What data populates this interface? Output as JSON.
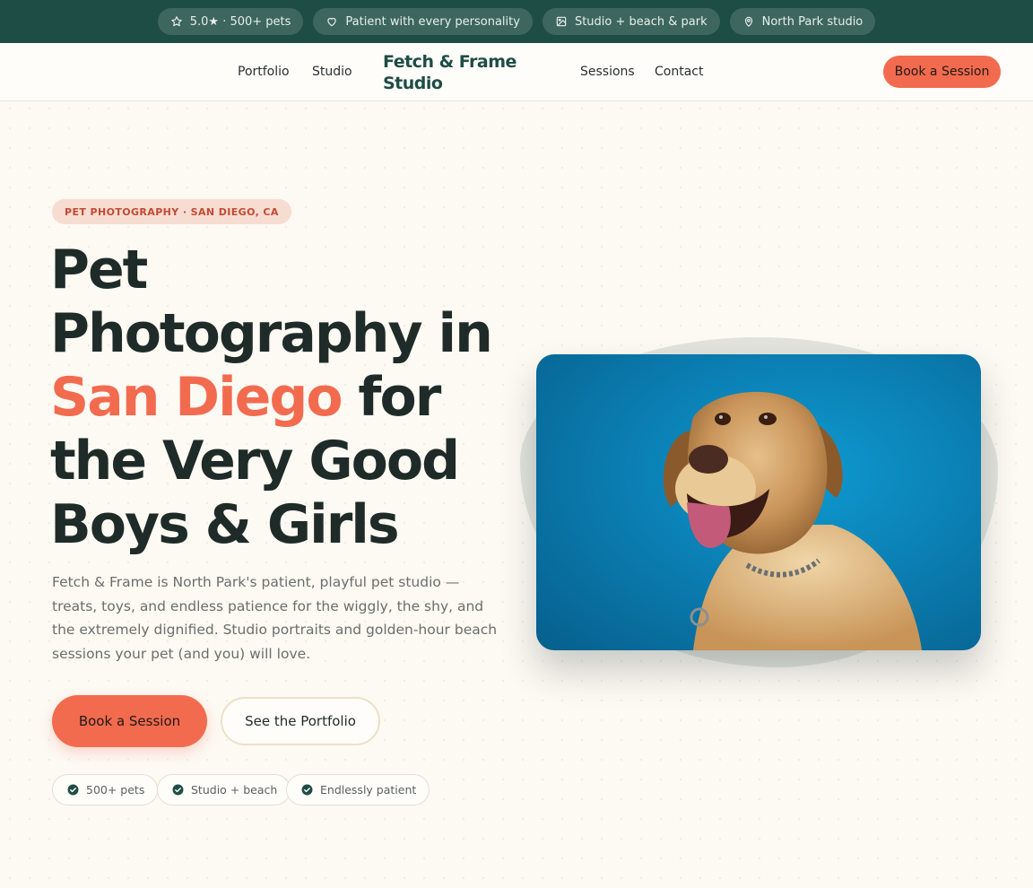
{
  "topbar": {
    "items": [
      {
        "icon": "star-icon",
        "label": "5.0★ · 500+ pets"
      },
      {
        "icon": "heart-icon",
        "label": "Patient with every personality"
      },
      {
        "icon": "image-icon",
        "label": "Studio + beach & park"
      },
      {
        "icon": "map-pin-icon",
        "label": "North Park studio"
      }
    ]
  },
  "nav": {
    "links": [
      "Portfolio",
      "Studio",
      "Sessions",
      "Contact"
    ],
    "logo_line1": "Fetch & Frame",
    "logo_line2": "Studio",
    "cta": "Book a Session"
  },
  "hero": {
    "eyebrow": "PET PHOTOGRAPHY · SAN DIEGO, CA",
    "headline_line1": "Pet",
    "headline_line2": "Photography in",
    "headline_accent": "San Diego",
    "headline_line3_rest": " for",
    "headline_line4": "the Very Good",
    "headline_line5": "Boys & Girls",
    "lede": "Fetch & Frame is North Park's patient, playful pet studio — treats, toys, and endless patience for the wiggly, the shy, and the extremely dignified. Studio portraits and golden-hour beach sessions your pet (and you) will love.",
    "primary_cta": "Book a Session",
    "secondary_cta": "See the Portfolio",
    "chips": [
      "500+ pets",
      "Studio + beach",
      "Endlessly patient"
    ]
  },
  "colors": {
    "brand_green": "#1e4d45",
    "accent_coral": "#f26b4f",
    "background": "#fdf9f3"
  }
}
